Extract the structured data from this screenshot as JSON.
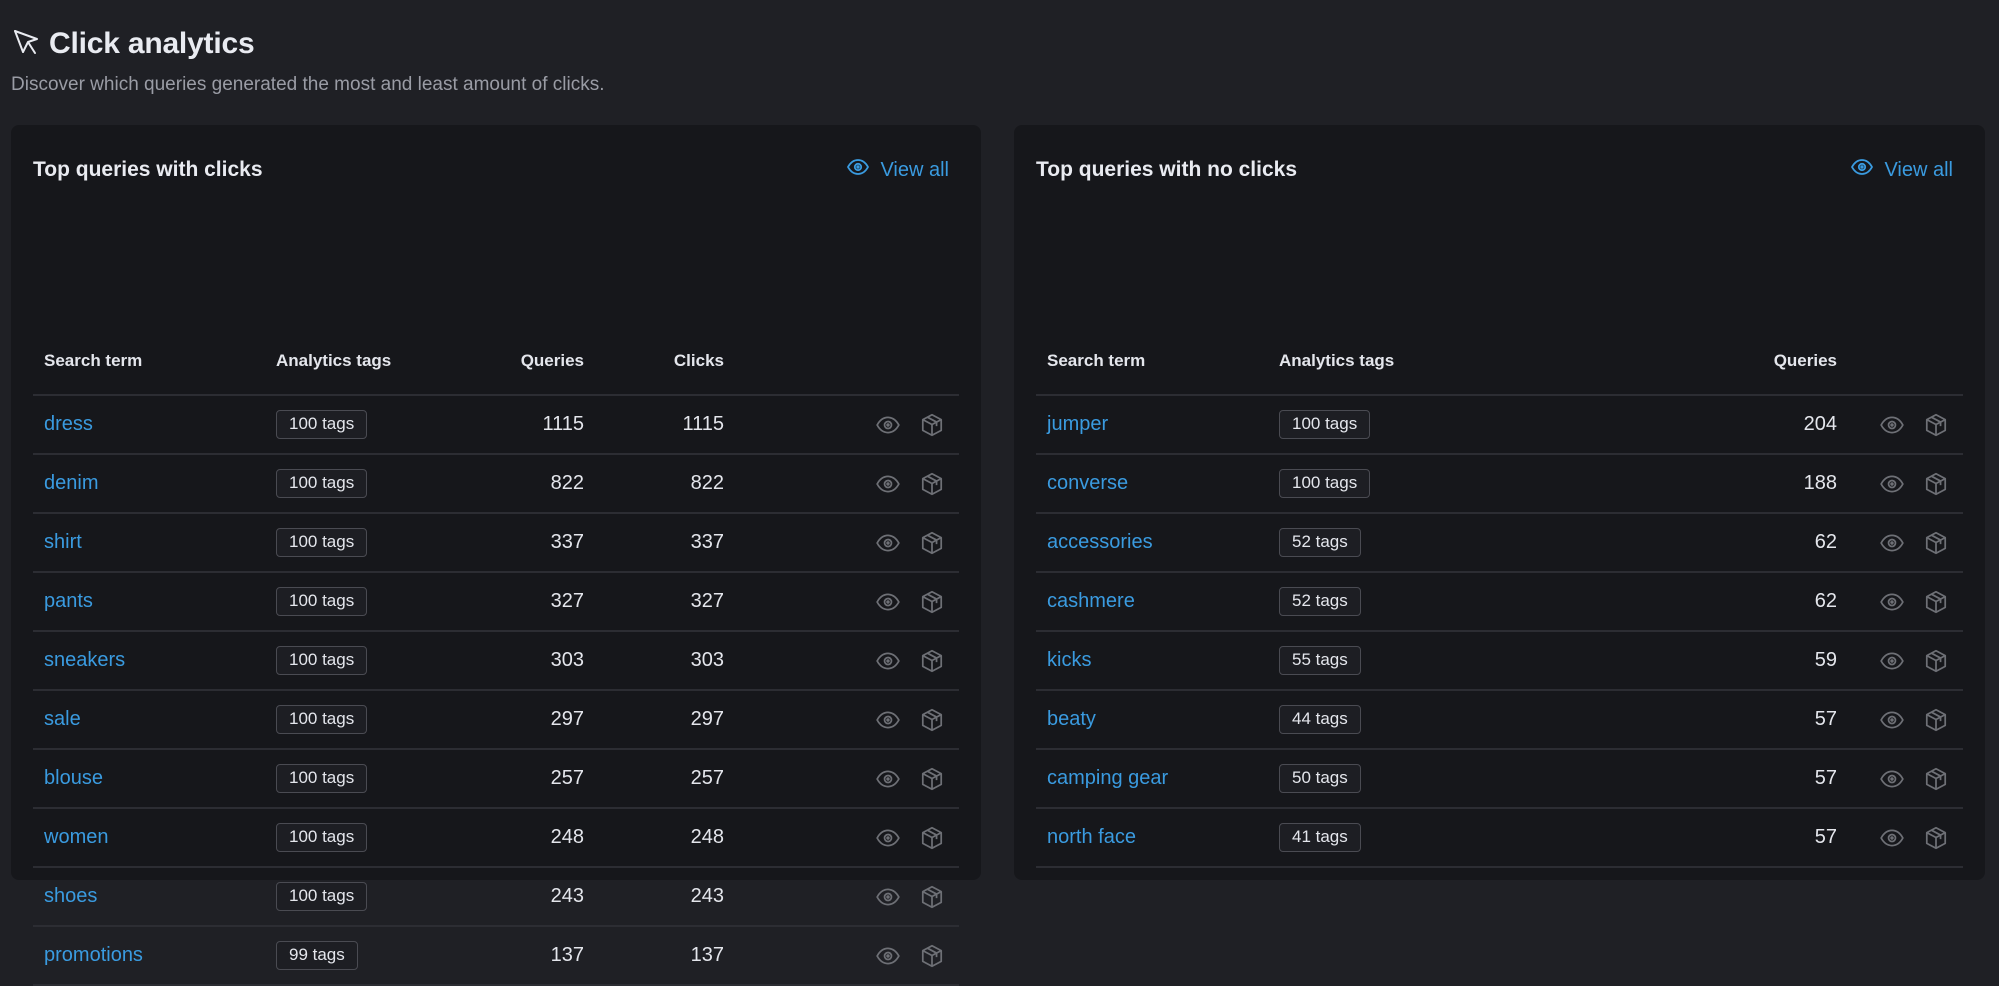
{
  "page": {
    "title": "Click analytics",
    "subtitle": "Discover which queries generated the most and least amount of clicks.",
    "icon": "cursor-arrow-icon"
  },
  "colors": {
    "background": "#1f2025",
    "panel": "#16171b",
    "accent": "#3a9be0",
    "text": "#e4e6ec",
    "muted": "#9a9ca5",
    "icon_muted": "#6e7076"
  },
  "top_with_clicks": {
    "title": "Top queries with clicks",
    "view_all_label": "View all",
    "columns": {
      "term": "Search term",
      "tags": "Analytics tags",
      "queries": "Queries",
      "clicks": "Clicks"
    },
    "rows": [
      {
        "term": "dress",
        "tags": "100 tags",
        "queries": "1115",
        "clicks": "1115"
      },
      {
        "term": "denim",
        "tags": "100 tags",
        "queries": "822",
        "clicks": "822"
      },
      {
        "term": "shirt",
        "tags": "100 tags",
        "queries": "337",
        "clicks": "337"
      },
      {
        "term": "pants",
        "tags": "100 tags",
        "queries": "327",
        "clicks": "327"
      },
      {
        "term": "sneakers",
        "tags": "100 tags",
        "queries": "303",
        "clicks": "303"
      },
      {
        "term": "sale",
        "tags": "100 tags",
        "queries": "297",
        "clicks": "297"
      },
      {
        "term": "blouse",
        "tags": "100 tags",
        "queries": "257",
        "clicks": "257"
      },
      {
        "term": "women",
        "tags": "100 tags",
        "queries": "248",
        "clicks": "248"
      },
      {
        "term": "shoes",
        "tags": "100 tags",
        "queries": "243",
        "clicks": "243"
      },
      {
        "term": "promotions",
        "tags": "99 tags",
        "queries": "137",
        "clicks": "137"
      }
    ]
  },
  "top_no_clicks": {
    "title": "Top queries with no clicks",
    "view_all_label": "View all",
    "columns": {
      "term": "Search term",
      "tags": "Analytics tags",
      "queries": "Queries"
    },
    "rows": [
      {
        "term": "jumper",
        "tags": "100 tags",
        "queries": "204"
      },
      {
        "term": "converse",
        "tags": "100 tags",
        "queries": "188"
      },
      {
        "term": "accessories",
        "tags": "52 tags",
        "queries": "62"
      },
      {
        "term": "cashmere",
        "tags": "52 tags",
        "queries": "62"
      },
      {
        "term": "kicks",
        "tags": "55 tags",
        "queries": "59"
      },
      {
        "term": "beaty",
        "tags": "44 tags",
        "queries": "57"
      },
      {
        "term": "camping gear",
        "tags": "50 tags",
        "queries": "57"
      },
      {
        "term": "north face",
        "tags": "41 tags",
        "queries": "57"
      }
    ]
  },
  "row_actions": [
    "eye-icon",
    "package-icon"
  ]
}
